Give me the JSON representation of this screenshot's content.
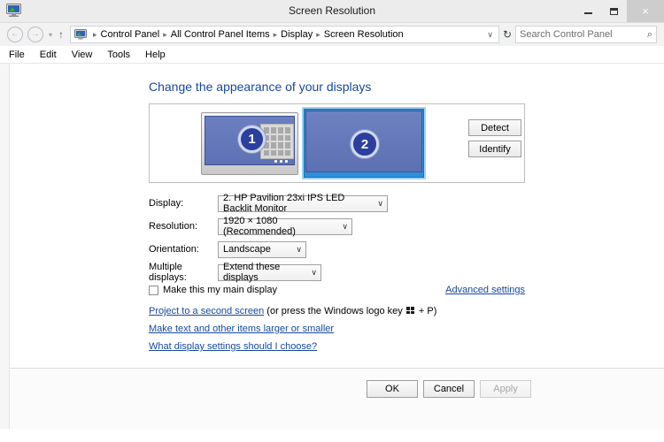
{
  "window": {
    "title": "Screen Resolution",
    "icon": "display-monitor-icon",
    "controls": {
      "minimize": "minimize-icon",
      "maximize": "restore-icon",
      "close": "×"
    }
  },
  "addressbar": {
    "back": "←",
    "forward": "→",
    "history_caret": "▾",
    "up": "↑",
    "crumb_icon": "control-panel-icon",
    "breadcrumbs": [
      "Control Panel",
      "All Control Panel Items",
      "Display",
      "Screen Resolution"
    ],
    "separator": "▸",
    "dropdown_caret": "∨",
    "refresh": "↻",
    "search": {
      "placeholder": "Search Control Panel",
      "icon": "⌕"
    }
  },
  "menubar": {
    "items": [
      "File",
      "Edit",
      "View",
      "Tools",
      "Help"
    ]
  },
  "main": {
    "heading": "Change the appearance of your displays",
    "preview": {
      "monitors": [
        {
          "number": "1",
          "selected": false
        },
        {
          "number": "2",
          "selected": true
        }
      ],
      "buttons": {
        "detect": "Detect",
        "identify": "Identify"
      }
    },
    "fields": [
      {
        "label": "Display:",
        "value": "2. HP Pavilion 23xi IPS LED Backlit Monitor"
      },
      {
        "label": "Resolution:",
        "value": "1920 × 1080 (Recommended)"
      },
      {
        "label": "Orientation:",
        "value": "Landscape"
      },
      {
        "label": "Multiple displays:",
        "value": "Extend these displays"
      }
    ],
    "caret": "∨",
    "main_display_checkbox": {
      "label": "Make this my main display",
      "checked": false
    },
    "advanced_settings": "Advanced settings",
    "links": {
      "project_prefix": "Project to a second screen",
      "project_mid": " (or press the Windows logo key ",
      "project_suffix": " + P)",
      "make_text": "Make text and other items larger or smaller",
      "what_settings": "What display settings should I choose?"
    }
  },
  "footer": {
    "ok": "OK",
    "cancel": "Cancel",
    "apply": "Apply"
  }
}
